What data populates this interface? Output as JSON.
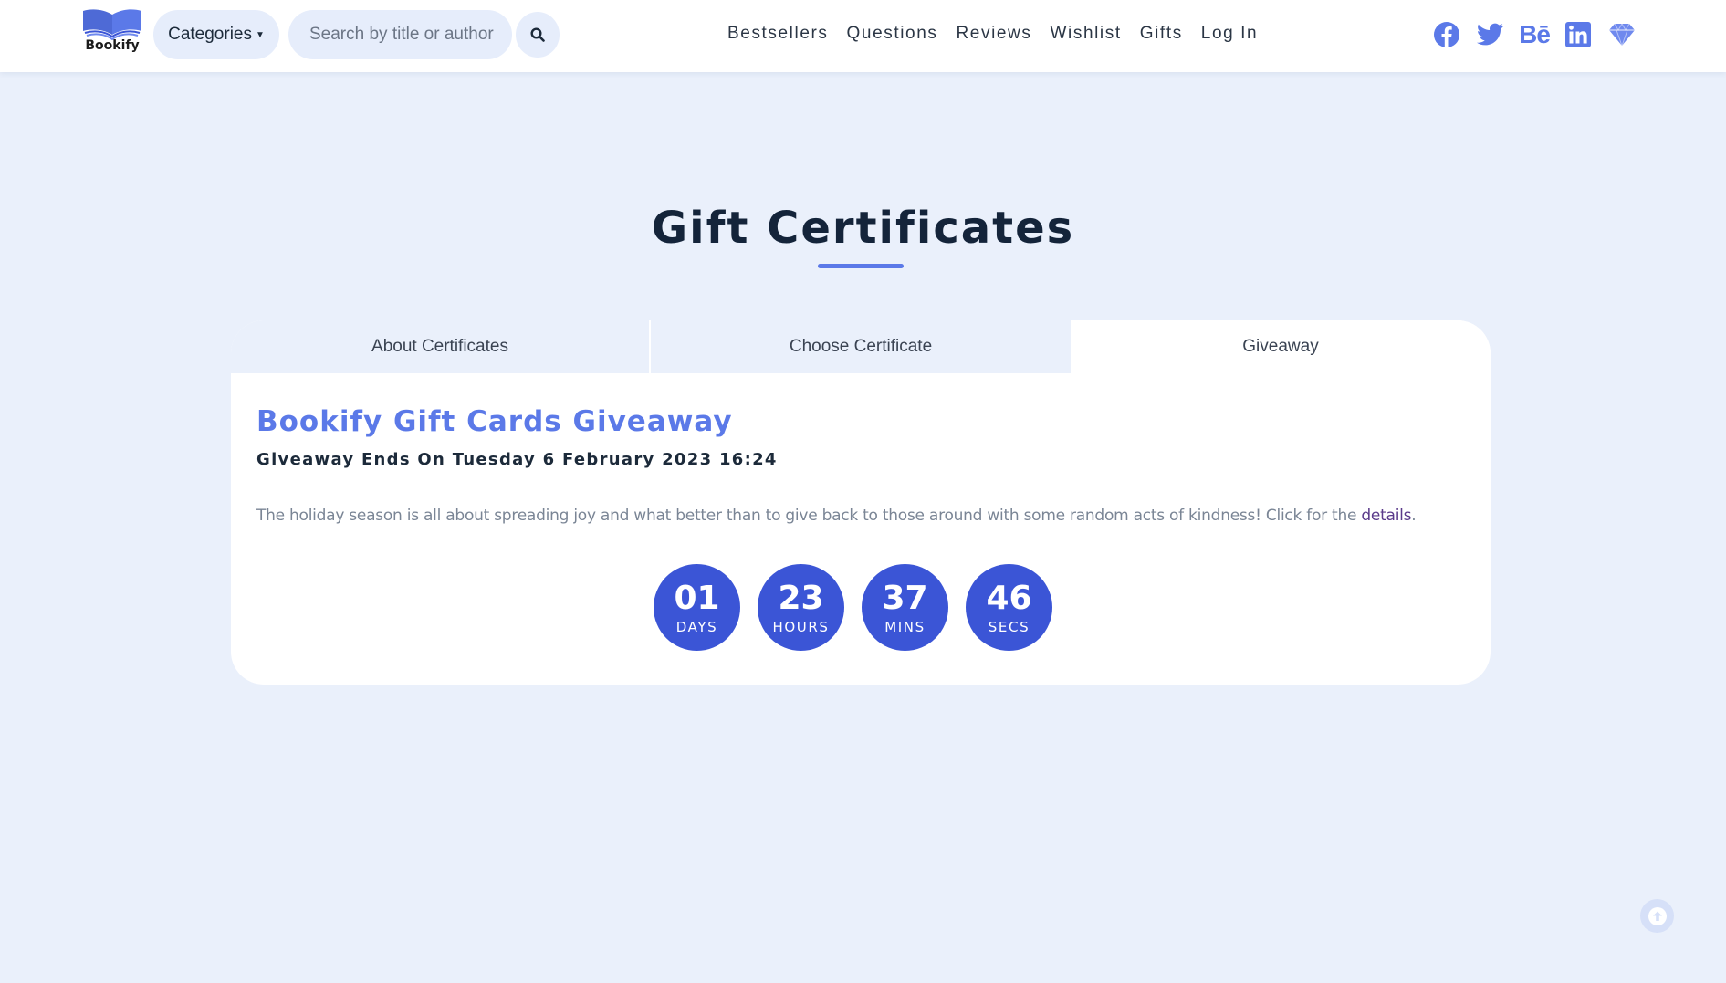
{
  "brand": {
    "name": "Bookify",
    "accent": "#5b79e8",
    "countdown_bg": "#3b55d6"
  },
  "header": {
    "categories_label": "Categories",
    "search_placeholder": "Search by title or author",
    "nav": [
      "Bestsellers",
      "Questions",
      "Reviews",
      "Wishlist",
      "Gifts",
      "Log In"
    ],
    "social_icons": [
      "facebook-icon",
      "twitter-icon",
      "behance-icon",
      "linkedin-icon",
      "diamond-icon"
    ],
    "behance_glyph": "Bē"
  },
  "page": {
    "title": "Gift Certificates"
  },
  "tabs": [
    {
      "label": "About Certificates",
      "active": false
    },
    {
      "label": "Choose Certificate",
      "active": false
    },
    {
      "label": "Giveaway",
      "active": true
    }
  ],
  "giveaway": {
    "title": "Bookify Gift Cards Giveaway",
    "ends": "Giveaway Ends On Tuesday 6 February 2023 16:24",
    "description": "The holiday season is all about spreading joy and what better than to give back to those around with some random acts of kindness! Click for the ",
    "link_text": "details",
    "description_end": "."
  },
  "countdown": [
    {
      "value": "01",
      "label": "DAYS"
    },
    {
      "value": "23",
      "label": "HOURS"
    },
    {
      "value": "37",
      "label": "MINS"
    },
    {
      "value": "46",
      "label": "SECS"
    }
  ]
}
